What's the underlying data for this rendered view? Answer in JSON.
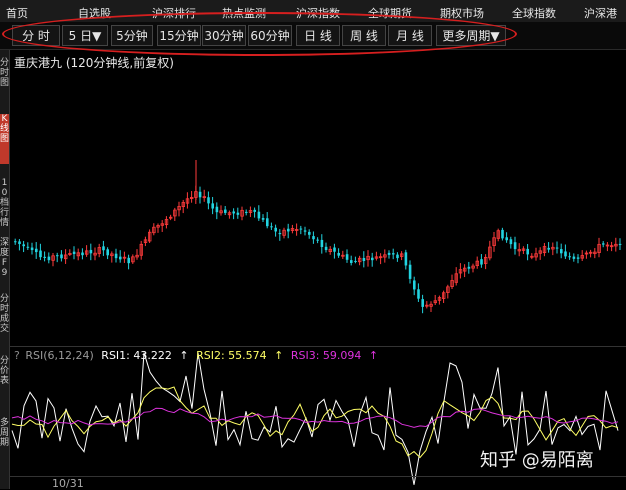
{
  "top_nav": [
    "首页",
    "自选股",
    "沪深排行",
    "热点监测",
    "沪深指数",
    "全球期货",
    "期权市场",
    "全球指数",
    "沪深港"
  ],
  "period_toolbar": [
    "分 时",
    "5 日▼",
    "5分钟",
    "15分钟",
    "30分钟",
    "60分钟",
    "日 线",
    "周 线",
    "月 线",
    "更多周期▼"
  ],
  "sidebar_tabs": [
    {
      "label": "分时图",
      "active": false
    },
    {
      "label": "K线图",
      "active": true
    },
    {
      "label": "10档行情",
      "active": false
    },
    {
      "label": "深度F9",
      "active": false
    },
    {
      "label": "分时成交",
      "active": false
    },
    {
      "label": "分价表",
      "active": false
    },
    {
      "label": "多周期",
      "active": false
    }
  ],
  "chart_title": "重庆港九 (120分钟线,前复权)",
  "indicator": {
    "name": "RSI(6,12,24)",
    "rsi1_label": "RSI1: 43.222",
    "rsi2_label": "RSI2: 55.574",
    "rsi3_label": "RSI3: 59.094",
    "arrow": "↑",
    "colors": {
      "rsi1": "#ffffff",
      "rsi2": "#ffff66",
      "rsi3": "#dd33dd",
      "rsi_name": "#9a9a9a"
    }
  },
  "date_label": "10/31",
  "watermark": "知乎 @易陌离",
  "colors": {
    "up": "#ff3b3b",
    "down": "#22d3e0",
    "annotation": "#d61f1f"
  }
}
